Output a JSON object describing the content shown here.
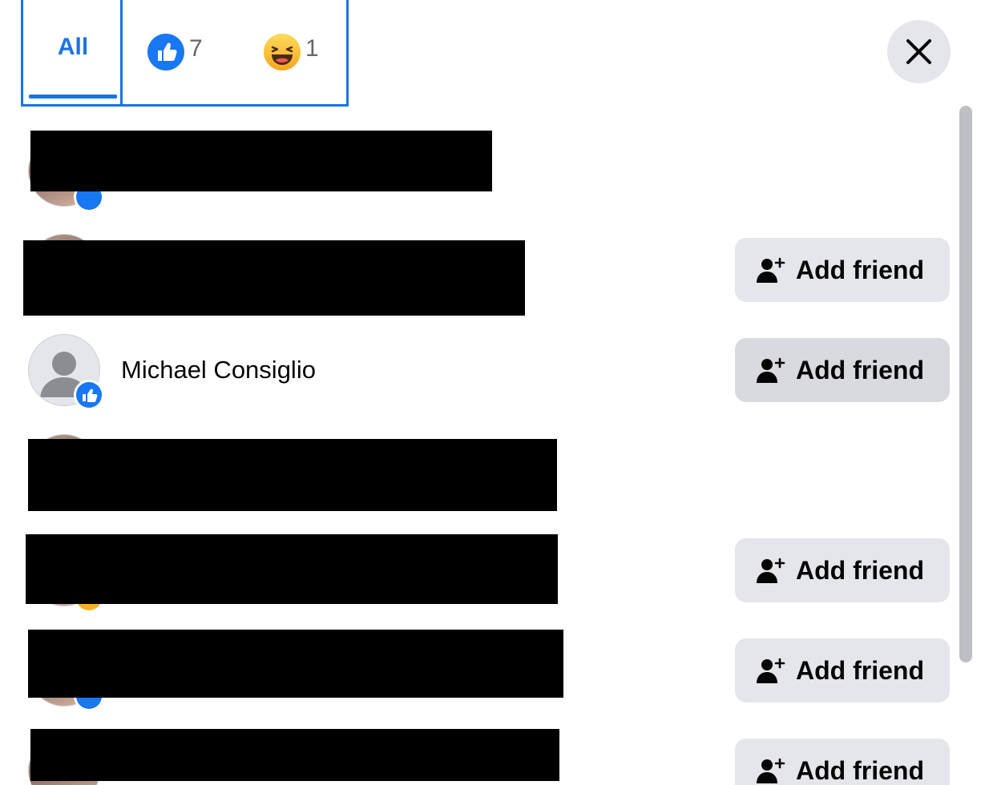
{
  "tabs": {
    "all_label": "All",
    "like_count": "7",
    "haha_count": "1",
    "accent_color": "#1b74e4"
  },
  "close_icon": "close-icon",
  "rows": [
    {
      "name": "",
      "redacted": true,
      "reaction": "like",
      "has_button": false
    },
    {
      "name": "",
      "redacted": true,
      "reaction": "like",
      "has_button": true
    },
    {
      "name": "Michael Consiglio",
      "redacted": false,
      "reaction": "like",
      "has_button": true
    },
    {
      "name": "",
      "redacted": true,
      "reaction": "like",
      "has_button": false
    },
    {
      "name": "",
      "redacted": true,
      "reaction": "haha",
      "has_button": true
    },
    {
      "name": "",
      "redacted": true,
      "reaction": "like",
      "has_button": true
    },
    {
      "name": "",
      "redacted": true,
      "reaction": "like",
      "has_button": true
    }
  ],
  "add_friend_label": "Add friend",
  "icons": {
    "like": "thumbs-up-icon",
    "haha": "laughing-face-icon",
    "add_friend": "add-person-icon",
    "default_avatar": "default-user-icon"
  }
}
